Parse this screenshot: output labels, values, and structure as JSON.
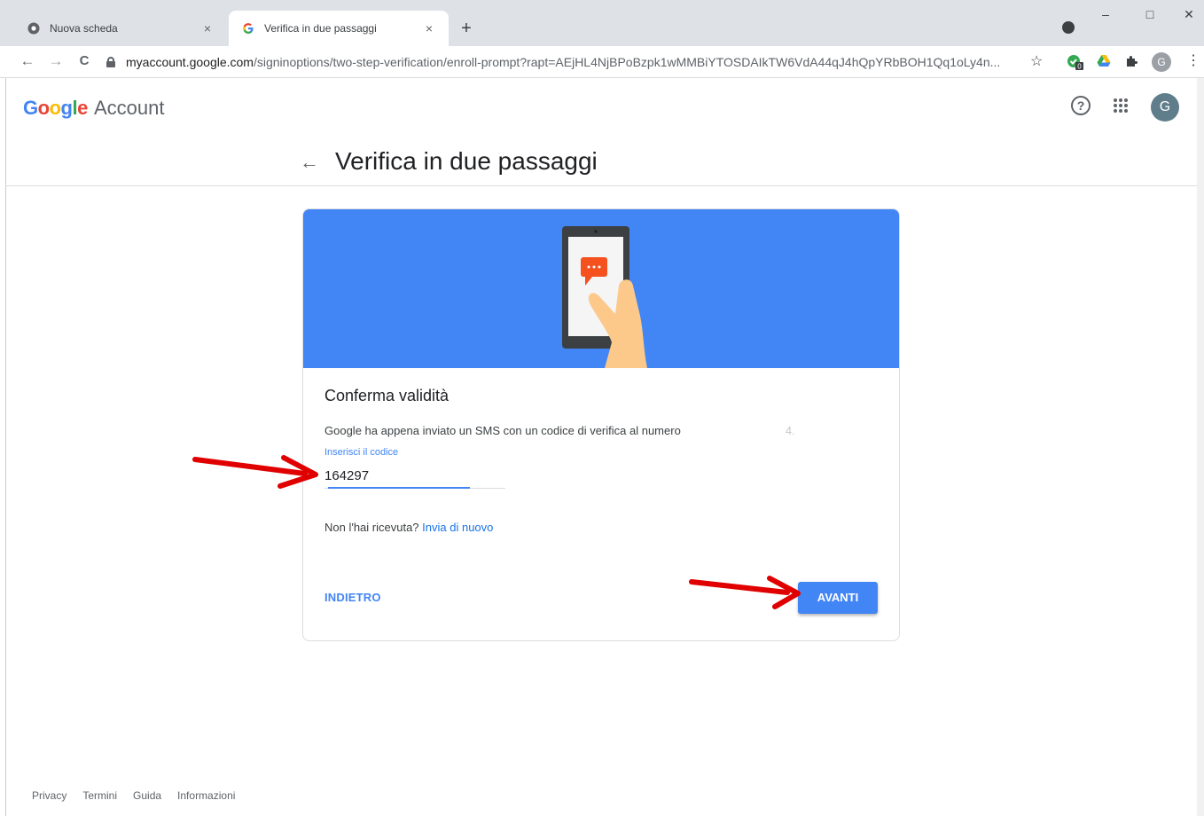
{
  "browser": {
    "tabs": [
      {
        "title": "Nuova scheda",
        "close": "×"
      },
      {
        "title": "Verifica in due passaggi",
        "close": "×"
      }
    ],
    "new_tab": "+",
    "window_controls": {
      "minimize": "–",
      "maximize": "□",
      "close": "✕"
    },
    "nav": {
      "back": "←",
      "forward": "→",
      "reload": "C"
    },
    "url": {
      "host": "myaccount.google.com",
      "path": "/signinoptions/two-step-verification/enroll-prompt?rapt=AEjHL4NjBPoBzpk1wMMBiYTOSDAIkTW6VdA44qJ4hQpYRbBOH1Qq1oLy4n..."
    },
    "bookmark_star": "☆",
    "extension_badge": "0",
    "profile_initial": "G"
  },
  "header": {
    "logo_letters": [
      "G",
      "o",
      "o",
      "g",
      "l",
      "e"
    ],
    "logo_suffix": "Account",
    "help_glyph": "?",
    "avatar_initial": "G"
  },
  "page": {
    "back_glyph": "←",
    "title": "Verifica in due passaggi"
  },
  "card": {
    "title": "Conferma validità",
    "description": "Google ha appena inviato un SMS con un codice di verifica al numero",
    "description_tail": "4.",
    "field_label": "Inserisci il codice",
    "field_value": "164297",
    "resend_prefix": "Non l'hai ricevuta?",
    "resend_link": "Invia di nuovo",
    "back_button": "INDIETRO",
    "next_button": "AVANTI"
  },
  "footer": {
    "links": [
      "Privacy",
      "Termini",
      "Guida",
      "Informazioni"
    ]
  },
  "colors": {
    "accent": "#4285f4",
    "annotation_arrow": "#e00000"
  }
}
